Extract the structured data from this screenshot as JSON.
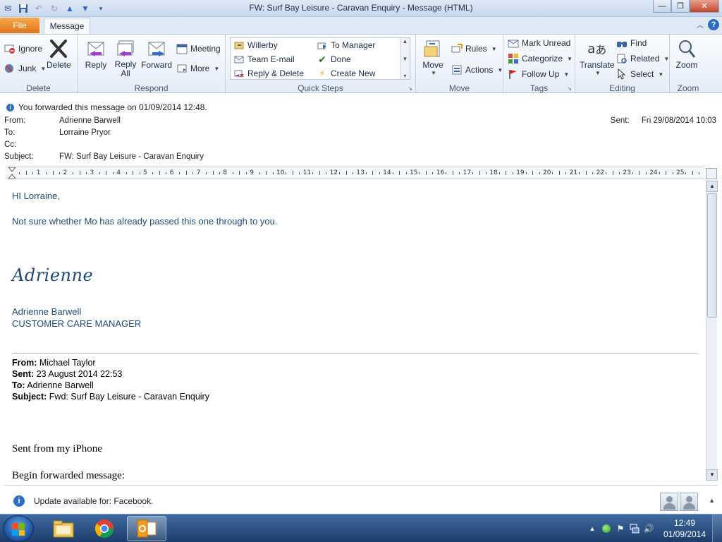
{
  "window": {
    "title": "FW: Surf Bay Leisure - Caravan Enquiry  -  Message (HTML)",
    "controls": [
      "minimize",
      "restore",
      "close"
    ]
  },
  "quick_access": [
    "mail-icon",
    "save-icon",
    "undo-icon",
    "redo-icon",
    "up-arrow-icon",
    "down-arrow-icon",
    "customize-icon"
  ],
  "tabs": {
    "file": "File",
    "message": "Message"
  },
  "ribbon": {
    "delete_group": {
      "label": "Delete",
      "ignore": "Ignore",
      "junk": "Junk",
      "delete": "Delete"
    },
    "respond_group": {
      "label": "Respond",
      "reply": "Reply",
      "reply_all_1": "Reply",
      "reply_all_2": "All",
      "forward": "Forward",
      "meeting": "Meeting",
      "more": "More"
    },
    "quick_steps_group": {
      "label": "Quick Steps",
      "items": [
        "Willerby",
        "To Manager",
        "Team E-mail",
        "Done",
        "Reply & Delete",
        "Create New"
      ]
    },
    "move_group": {
      "label": "Move",
      "move": "Move",
      "rules": "Rules",
      "actions": "Actions"
    },
    "tags_group": {
      "label": "Tags",
      "mark_unread": "Mark Unread",
      "categorize": "Categorize",
      "follow_up": "Follow Up"
    },
    "editing_group": {
      "label": "Editing",
      "translate": "Translate",
      "find": "Find",
      "related": "Related",
      "select": "Select"
    },
    "zoom_group": {
      "label": "Zoom",
      "zoom": "Zoom"
    }
  },
  "message": {
    "info_bar": "You forwarded this message on 01/09/2014 12:48.",
    "from_label": "From:",
    "from": "Adrienne Barwell",
    "to_label": "To:",
    "to": "Lorraine Pryor",
    "cc_label": "Cc:",
    "cc": "",
    "subject_label": "Subject:",
    "subject": "FW: Surf Bay Leisure - Caravan Enquiry",
    "sent_label": "Sent:",
    "sent": "Fri 29/08/2014 10:03"
  },
  "ruler": {
    "numbers": [
      "1",
      "2",
      "3",
      "4",
      "5",
      "6",
      "7",
      "8",
      "9",
      "10",
      "11",
      "12",
      "13",
      "14",
      "15",
      "16",
      "17",
      "18",
      "19",
      "20",
      "21",
      "22",
      "23",
      "24",
      "25"
    ]
  },
  "body": {
    "greeting": "HI Lorraine,",
    "line1": "Not sure whether Mo has already passed this one through to you.",
    "signature_script": "Adrienne",
    "sig_name": "Adrienne Barwell",
    "sig_title": "CUSTOMER CARE MANAGER",
    "fwd_from_label": "From:",
    "fwd_from": " Michael Taylor",
    "fwd_sent_label": "Sent:",
    "fwd_sent": " 23 August 2014 22:53",
    "fwd_to_label": "To:",
    "fwd_to": " Adrienne Barwell",
    "fwd_subject_label": "Subject:",
    "fwd_subject": " Fwd: Surf Bay Leisure - Caravan Enquiry",
    "iphone": "Sent from my iPhone",
    "begin_fwd": "Begin forwarded message:"
  },
  "status": {
    "text": "Update available for: Facebook."
  },
  "taskbar": {
    "apps": [
      "explorer-icon",
      "chrome-icon",
      "outlook-icon"
    ],
    "time": "12:49",
    "date": "01/09/2014"
  }
}
